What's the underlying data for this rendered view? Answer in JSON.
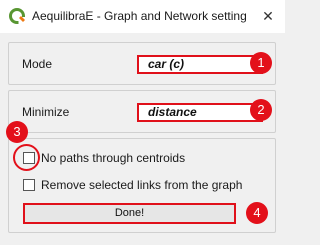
{
  "window": {
    "title": "AequilibraE - Graph and Network setting",
    "close_glyph": "✕",
    "app_icon": "qgis-logo-icon"
  },
  "mode": {
    "label": "Mode",
    "value": "car (c)"
  },
  "minimize": {
    "label": "Minimize",
    "value": "distance"
  },
  "options": {
    "no_paths_label": "No paths through centroids",
    "no_paths_checked": false,
    "remove_links_label": "Remove selected links from the graph",
    "remove_links_checked": false
  },
  "done_button": {
    "label": "Done!"
  },
  "annotations": {
    "badge_1": "1",
    "badge_2": "2",
    "badge_3": "3",
    "badge_4": "4"
  },
  "colors": {
    "annotation_red": "#e3101a",
    "window_bg": "#f0f0f0"
  }
}
